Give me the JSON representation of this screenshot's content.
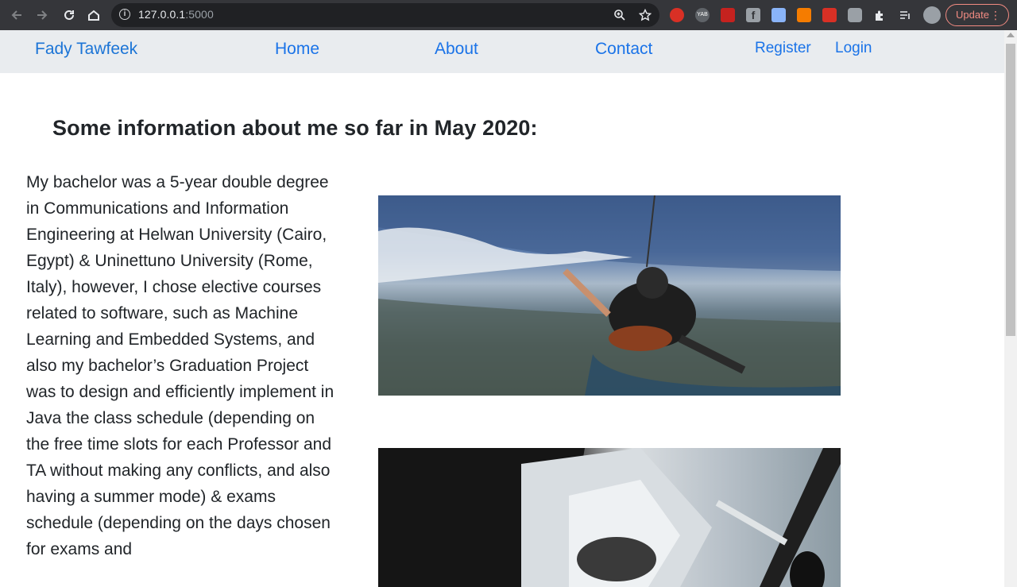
{
  "browser": {
    "url_host": "127.0.0.1",
    "url_port": ":5000",
    "update_label": "Update",
    "extensions": [
      "adblock-icon",
      "yab-icon",
      "acrobat-icon",
      "facebook-icon",
      "puzzle-blue-icon",
      "orange-on-icon",
      "red-play-icon",
      "camera-icon",
      "extensions-icon",
      "reading-list-icon",
      "avatar-icon"
    ]
  },
  "navbar": {
    "brand": "Fady Tawfeek",
    "links": [
      "Home",
      "About",
      "Contact"
    ],
    "auth": [
      "Register",
      "Login"
    ]
  },
  "main": {
    "heading": "Some information about me so far in May 2020:",
    "paragraph": "My bachelor was a 5-year double degree in Communications and Information Engineering at Helwan University (Cairo, Egypt) & Uninettuno University (Rome, Italy), however, I chose elective courses related to software, such as Machine Learning and Embedded Systems, and also my bachelor’s Graduation Project was to design and efficiently implement in Java the class schedule (depending on the free time slots for each Professor and TA without making any conflicts, and also having a summer mode) & exams schedule (depending on the days chosen for exams and"
  },
  "colors": {
    "link": "#1a73e8",
    "navbar_bg": "#e9ecef",
    "chrome_bg": "#35363a"
  }
}
